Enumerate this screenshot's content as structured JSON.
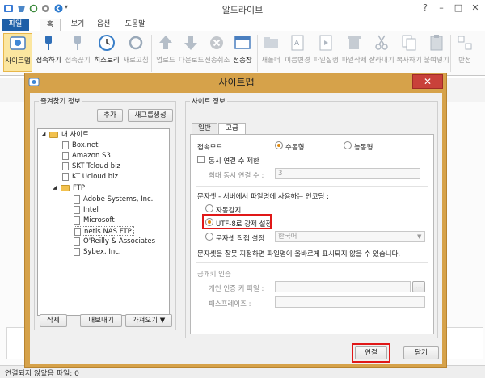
{
  "app": {
    "title": "알드라이브"
  },
  "window_controls": {
    "help": "?",
    "minimize": "–",
    "maximize": "□",
    "close": "✕"
  },
  "tabs": [
    {
      "label": "파일"
    },
    {
      "label": "홈"
    },
    {
      "label": "보기"
    },
    {
      "label": "옵션"
    },
    {
      "label": "도움말"
    }
  ],
  "ribbon": {
    "buttons": [
      {
        "label": "사이트맵",
        "icon": "sitemap-icon"
      },
      {
        "label": "접속하기",
        "icon": "connect-plug-icon"
      },
      {
        "label": "접속끊기",
        "icon": "disconnect-plug-icon"
      },
      {
        "label": "히스토리",
        "icon": "clock-history-icon"
      },
      {
        "label": "새로고침",
        "icon": "refresh-icon"
      },
      {
        "label": "업로드",
        "icon": "upload-arrow-icon"
      },
      {
        "label": "다운로드",
        "icon": "download-arrow-icon"
      },
      {
        "label": "전송취소",
        "icon": "cancel-transfer-icon"
      },
      {
        "label": "전송창",
        "icon": "transfer-window-icon"
      },
      {
        "label": "새폴더",
        "icon": "new-folder-icon"
      },
      {
        "label": "이름변경",
        "icon": "rename-icon"
      },
      {
        "label": "파일실행",
        "icon": "run-file-icon"
      },
      {
        "label": "파일삭제",
        "icon": "delete-file-icon"
      },
      {
        "label": "잘라내기",
        "icon": "scissors-icon"
      },
      {
        "label": "복사하기",
        "icon": "copy-icon"
      },
      {
        "label": "붙여넣기",
        "icon": "paste-icon"
      },
      {
        "label": "반전",
        "icon": "invert-selection-icon"
      }
    ]
  },
  "status": {
    "text": "연결되지 않았음   파일: 0"
  },
  "dialog": {
    "title": "사이트맵",
    "close": "✕",
    "bookmarks": {
      "legend": "즐겨찾기 정보",
      "add": "추가",
      "new_folder": "새그룹생성",
      "tree": [
        {
          "label": "내 사이트",
          "type": "folder"
        },
        {
          "label": "Box.net",
          "type": "site"
        },
        {
          "label": "Amazon S3",
          "type": "site"
        },
        {
          "label": "SKT Tcloud biz",
          "type": "site"
        },
        {
          "label": "KT Ucloud biz",
          "type": "site"
        },
        {
          "label": "FTP",
          "type": "folder"
        },
        {
          "label": "Adobe Systems, Inc.",
          "type": "site"
        },
        {
          "label": "Intel",
          "type": "site"
        },
        {
          "label": "Microsoft",
          "type": "site"
        },
        {
          "label": "netis NAS FTP",
          "type": "site"
        },
        {
          "label": "O'Reilly & Associates",
          "type": "site"
        },
        {
          "label": "Sybex, Inc.",
          "type": "site"
        }
      ],
      "delete": "삭제",
      "export": "내보내기",
      "import": "가져오기 ▼"
    },
    "site_info": {
      "legend": "사이트 정보",
      "tab_general": "일반",
      "tab_advanced": "고급",
      "conn_mode_label": "접속모드 :",
      "passive": "수동형",
      "active": "능동형",
      "limit_label": "동시 연결 수 제한",
      "max_label": "최대 동시 연결 수 :",
      "max_value": "3",
      "charset_title": "문자셋 - 서버에서 파일명에 사용하는 인코딩 :",
      "auto": "자동감지",
      "utf8": "UTF-8로 강제 설정",
      "manual": "문자셋 직접 설정",
      "charset_value": "한국어",
      "warning": "문자셋을 잘못 지정하면 파일명이 올바르게 표시되지 않을 수 있습니다.",
      "pubkey_title": "공개키 인증",
      "key_file_label": "개인 인증 키 파일 :",
      "passphrase_label": "패스프레이즈 :",
      "browse": "..."
    },
    "connect": "연결",
    "close_btn": "닫기"
  },
  "colors": {
    "accent": "#1e5fa8",
    "dialog_frame": "#d6a24a",
    "highlight": "#e01818",
    "close_red": "#c9413a"
  }
}
